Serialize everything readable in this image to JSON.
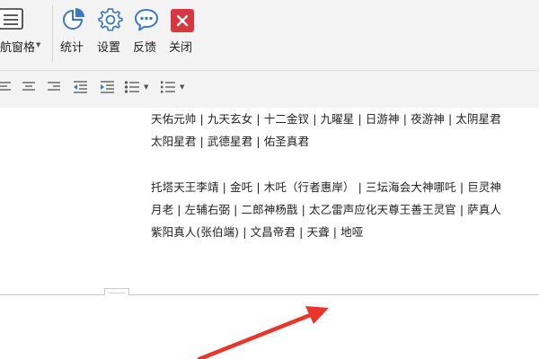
{
  "ribbon": {
    "navpane_label": "航窗格",
    "buttons": [
      {
        "label": "统计"
      },
      {
        "label": "设置"
      },
      {
        "label": "反馈"
      },
      {
        "label": "关闭"
      }
    ]
  },
  "document": {
    "lines": [
      "天佑元帅 | 九天玄女 | 十二金钗 | 九曜星 | 日游神 | 夜游神 | 太阴星君",
      "太阳星君 | 武德星君 | 佑圣真君",
      "托塔天王李靖 | 金吒 | 木吒（行者惠岸） | 三坛海会大神哪吒 | 巨灵神",
      "月老 | 左辅右弼 | 二郎神杨戬 | 太乙雷声应化天尊王善王灵官 | 萨真人",
      "紫阳真人(张伯端) | 文昌帝君 | 天聋 | 地哑"
    ]
  },
  "colors": {
    "ribbon_bg": "#f3f3f3",
    "accent_blue": "#3a78c2",
    "close_red": "#d9363e",
    "annotation_arrow": "#e8362b"
  }
}
